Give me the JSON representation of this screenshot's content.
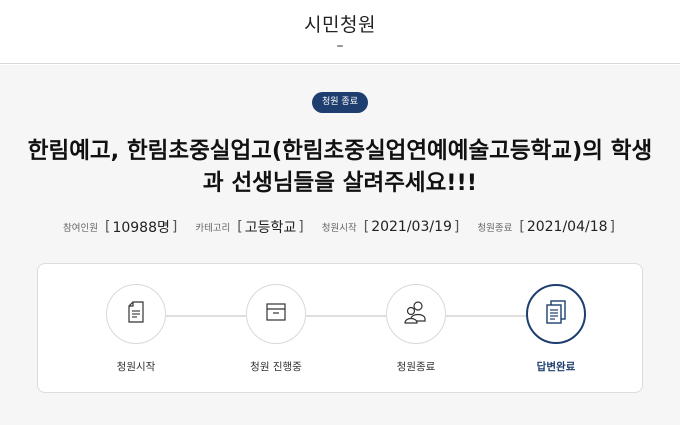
{
  "header": {
    "title": "시민청원",
    "dash": "–"
  },
  "petition": {
    "status_badge": "청원 종료",
    "title": "한림예고, 한림초중실업고(한림초중실업연예예술고등학교)의 학생과 선생님들을 살려주세요!!!",
    "meta": {
      "participants_label": "참여인원",
      "participants_value": "10988명",
      "category_label": "카테고리",
      "category_value": "고등학교",
      "start_label": "청원시작",
      "start_value": "2021/03/19",
      "end_label": "청원종료",
      "end_value": "2021/04/18"
    }
  },
  "progress": {
    "steps": [
      {
        "label": "청원시작",
        "icon": "document-icon"
      },
      {
        "label": "청원 진행중",
        "icon": "inbox-tray-icon"
      },
      {
        "label": "청원종료",
        "icon": "people-icon"
      },
      {
        "label": "답변완료",
        "icon": "documents-stack-icon"
      }
    ],
    "active_step": "답변완료"
  },
  "colors": {
    "accent": "#1d3e6e",
    "background": "#f6f6f6"
  }
}
